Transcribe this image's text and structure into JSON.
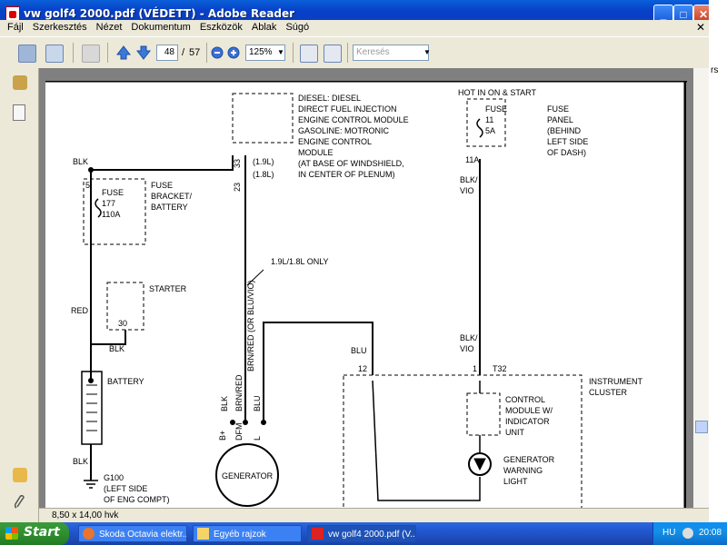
{
  "window": {
    "title": "vw golf4 2000.pdf (VÉDETT) - Adobe Reader",
    "buttons": {
      "minimize": "_",
      "maximize": "□",
      "close": "✕"
    },
    "doc_close": "✕"
  },
  "menu": [
    "Fájl",
    "Szerkesztés",
    "Nézet",
    "Dokumentum",
    "Eszközök",
    "Ablak",
    "Súgó"
  ],
  "toolbar": {
    "page_current": "48",
    "page_separator": "/",
    "page_total": "57",
    "zoom": "125%",
    "search_placeholder": "Keresés"
  },
  "status": {
    "page_size": "8,50 x 14,00 hvk"
  },
  "side_strip_text": "rs",
  "diagram": {
    "diesel_module": [
      "DIESEL: DIESEL",
      "DIRECT FUEL INJECTION",
      "ENGINE CONTROL MODULE",
      "GASOLINE: MOTRONIC",
      "ENGINE CONTROL",
      "MODULE",
      "(AT BASE OF WINDSHIELD,",
      "IN CENTER OF PLENUM)"
    ],
    "pin_33": "33",
    "pin_23": "23",
    "engine_19": "(1.9L)",
    "engine_18": "(1.8L)",
    "hot_in": "HOT IN ON & START",
    "fuse11": [
      "FUSE",
      "11",
      "5A"
    ],
    "fuse_panel": [
      "FUSE",
      "PANEL",
      "(BEHIND",
      "LEFT SIDE",
      "OF DASH)"
    ],
    "pin_11a": "11A",
    "blk_vio_1": [
      "BLK/",
      "VIO"
    ],
    "blk_top": "BLK",
    "fuse177": [
      "FUSE",
      "177",
      "110A"
    ],
    "pin_5": "5",
    "fuse_bracket": [
      "FUSE",
      "BRACKET/",
      "BATTERY"
    ],
    "only_note": "1.9L/1.8L ONLY",
    "wire_brn_red_or": "BRN/RED (OR BLU/VIO)",
    "starter": "STARTER",
    "pin_30": "30",
    "red": "RED",
    "blk_starter": "BLK",
    "blu_top": "BLU",
    "blk_vio_2": [
      "BLK/",
      "VIO"
    ],
    "pin_12": "12",
    "pin_1": "1",
    "t32": "T32",
    "instrument_cluster": [
      "INSTRUMENT",
      "CLUSTER"
    ],
    "battery": "BATTERY",
    "blk_gen": "BLK",
    "brn_red": "BRN/RED",
    "blu_gen": "BLU",
    "control_module": [
      "CONTROL",
      "MODULE W/",
      "INDICATOR",
      "UNIT"
    ],
    "gen_pins": [
      "B+",
      "DFM",
      "L"
    ],
    "generator": "GENERATOR",
    "gen_warning": [
      "GENERATOR",
      "WARNING",
      "LIGHT"
    ],
    "blk_ground": "BLK",
    "g100": [
      "G100",
      "(LEFT SIDE",
      "OF ENG COMPT)"
    ]
  },
  "taskbar": {
    "start": "Start",
    "tasks": [
      "Skoda Octavia elektr...",
      "Egyéb rajzok",
      "vw golf4 2000.pdf (V..."
    ],
    "lang": "HU",
    "clock": "20:08"
  }
}
